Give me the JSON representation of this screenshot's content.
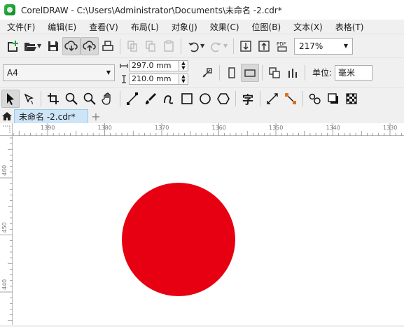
{
  "window": {
    "title": "CorelDRAW - C:\\Users\\Administrator\\Documents\\未命名 -2.cdr*"
  },
  "menu": [
    "文件(F)",
    "编辑(E)",
    "查看(V)",
    "布局(L)",
    "对象(J)",
    "效果(C)",
    "位图(B)",
    "文本(X)",
    "表格(T)"
  ],
  "toolbar": {
    "zoom_value": "217%",
    "pdf_label": "PDF"
  },
  "property_bar": {
    "page_size": "A4",
    "width": "297.0 mm",
    "height": "210.0 mm",
    "units_label": "单位:",
    "units_value": "毫米"
  },
  "toolbox": {
    "text_tool_glyph": "字"
  },
  "tabs": {
    "document": "未命名 -2.cdr*",
    "add": "+"
  },
  "ruler": {
    "horizontal_labels": [
      "1390",
      "1380",
      "1370",
      "1360",
      "1350",
      "1340",
      "1330"
    ],
    "vertical_labels": [
      "460",
      "450",
      "440"
    ]
  },
  "canvas": {
    "shape": "circle",
    "fill_color": "#e60012"
  }
}
